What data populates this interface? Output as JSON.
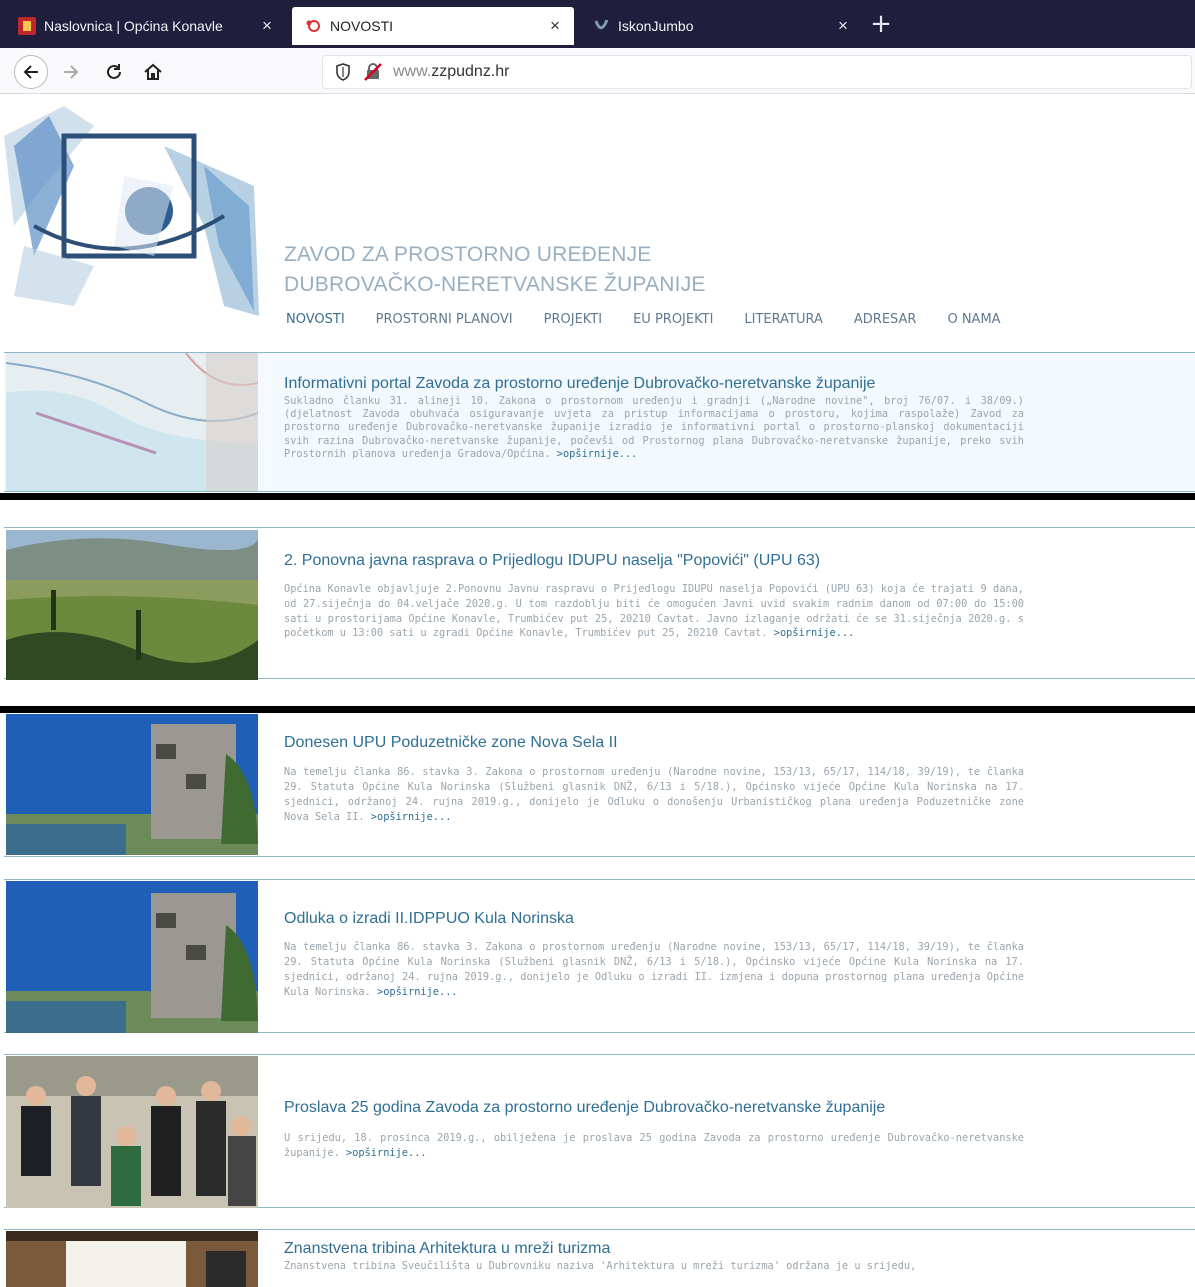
{
  "tabs": [
    {
      "title": "Naslovnica | Općina Konavle",
      "close": "×"
    },
    {
      "title": "NOVOSTI",
      "close": "×"
    },
    {
      "title": "IskonJumbo",
      "close": "×"
    }
  ],
  "new_tab": "+",
  "url": {
    "prefix": "www.",
    "domain": "zzpudnz.hr"
  },
  "site": {
    "title_line1": "ZAVOD ZA PROSTORNO UREĐENJE",
    "title_line2": "DUBROVAČKO-NERETVANSKE ŽUPANIJE"
  },
  "menu": [
    "NOVOSTI",
    "PROSTORNI PLANOVI",
    "PROJEKTI",
    "EU PROJEKTI",
    "LITERATURA",
    "ADRESAR",
    "O NAMA"
  ],
  "articles": [
    {
      "title": "Informativni portal Zavoda za prostorno uređenje Dubrovačko-neretvanske županije",
      "text": "Sukladno članku 31. alineji 10. Zakona o prostornom uređenju i gradnji („Narodne novine\", broj 76/07. i 38/09.) (djelatnost Zavoda obuhvaća osiguravanje uvjeta za pristup informacijama o prostoru, kojima raspolaže) Zavod za prostorno uređenje Dubrovačko-neretvanske županije izradio je informativni portal o prostorno-planskoj dokumentaciji svih razina Dubrovačko-neretvanske županije, počevši od Prostornog plana Dubrovačko-neretvanske županije, preko svih Prostornih planova uređenja Gradova/Općina.",
      "more": ">opširnije..."
    },
    {
      "title": "2. Ponovna javna rasprava o Prijedlogu IDUPU naselja \"Popovići\" (UPU 63)",
      "text": "Općina Konavle objavljuje 2.Ponovnu Javnu raspravu o Prijedlogu IDUPU naselja Popovići (UPU 63) koja će trajati 9 dana, od 27.siječnja do 04.veljače 2020.g. U tom razdoblju biti će omogućen Javni uvid svakim radnim danom od 07:00 do 15:00 sati u prostorijama Općine Konavle, Trumbićev put 25, 20210 Cavtat. Javno izlaganje održati će se 31.siječnja 2020.g. s početkom u 13:00 sati u zgradi Općine Konavle, Trumbićev put 25, 20210 Cavtat.",
      "more": ">opširnije..."
    },
    {
      "title": "Donesen UPU Poduzetničke zone Nova Sela II",
      "text": "Na temelju članka 86. stavka 3. Zakona o prostornom uređenju (Narodne novine, 153/13, 65/17, 114/18, 39/19), te članka 29. Statuta Općine Kula Norinska (Službeni glasnik DNŽ, 6/13 i 5/18.), Općinsko vijeće Općine Kula Norinska na 17. sjednici, održanoj 24. rujna 2019.g., donijelo je Odluku o donošenju Urbanističkog plana uređenja Poduzetničke zone Nova Sela II.",
      "more": ">opširnije..."
    },
    {
      "title": "Odluka o izradi II.IDPPUO Kula Norinska",
      "text": "Na temelju članka 86. stavka 3. Zakona o prostornom uređenju (Narodne novine, 153/13, 65/17, 114/18, 39/19), te članka 29. Statuta Općine Kula Norinska (Službeni glasnik DNŽ, 6/13 i 5/18.), Općinsko vijeće Općine Kula Norinska na 17. sjednici, održanoj 24. rujna 2019.g., donijelo je Odluku o izradi II. izmjena i dopuna prostornog plana uređenja Općine Kula Norinska.",
      "more": ">opširnije..."
    },
    {
      "title": "Proslava 25 godina Zavoda za prostorno uređenje Dubrovačko-neretvanske županije",
      "text": "U srijedu, 18. prosinca 2019.g., obilježena je proslava 25 godina Zavoda za prostorno uređenje Dubrovačko-neretvanske županije.",
      "more": ">opširnije..."
    },
    {
      "title": "Znanstvena tribina Arhitektura u mreži turizma",
      "text": "Znanstvena tribina Sveučilišta u Dubrovniku naziva 'Arhitektura u mreži turizma' održana je u srijedu,",
      "more": ""
    }
  ]
}
